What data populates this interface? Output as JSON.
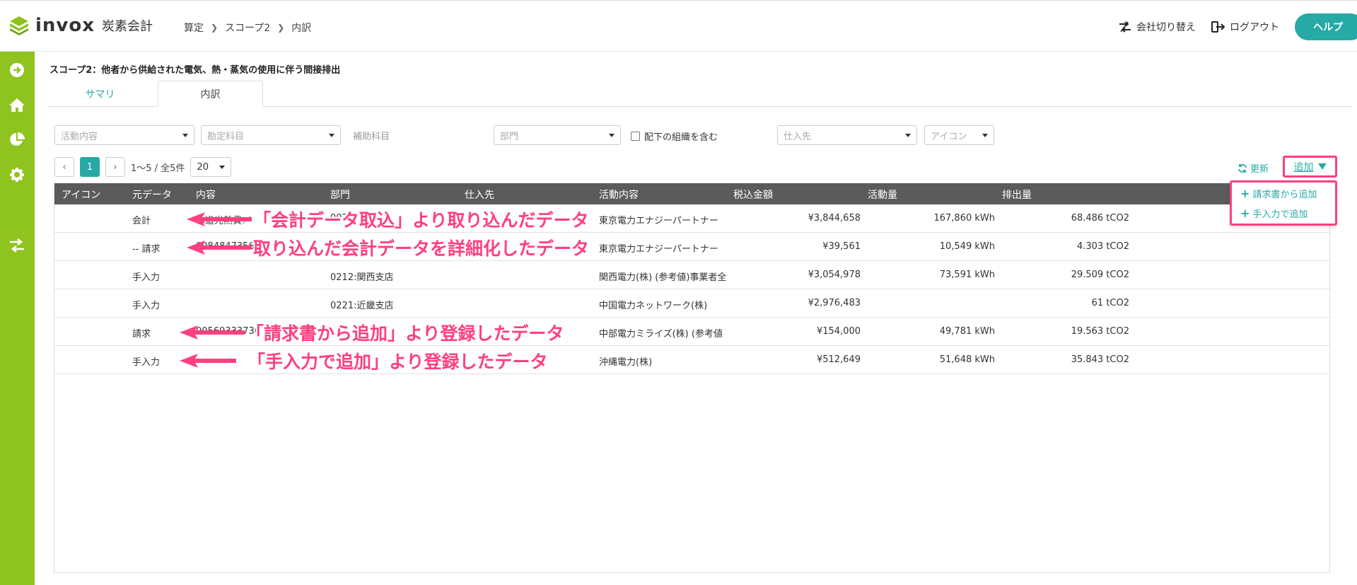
{
  "app": {
    "logo_text": "invox",
    "logo_sub": "炭素会計",
    "brand_color": "#8fc31f",
    "accent_color": "#27a9a6",
    "highlight_color": "#ff3f7f"
  },
  "breadcrumb": [
    "算定",
    "スコープ2",
    "内訳"
  ],
  "header": {
    "switch_company": "会社切り替え",
    "logout": "ログアウト",
    "help": "ヘルプ"
  },
  "sidebar": {
    "icons": [
      "arrow-right-circle-icon",
      "home-icon",
      "pie-chart-icon",
      "gear-icon",
      "swap-icon"
    ]
  },
  "page": {
    "title": "スコープ2：他者から供給された電気、熱・蒸気の使用に伴う間接排出"
  },
  "tabs": [
    {
      "label": "サマリ"
    },
    {
      "label": "内訳"
    }
  ],
  "filters": {
    "activity": "活動内容",
    "account": "勘定科目",
    "sub_account": "補助科目",
    "department": "部門",
    "include_sub_org": "配下の組織を含む",
    "supplier": "仕入先",
    "icon": "アイコン"
  },
  "pager": {
    "current": "1",
    "summary": "1〜5 / 全5件",
    "page_size": "20"
  },
  "toolbar": {
    "refresh": "更新",
    "add": "追加"
  },
  "add_menu": {
    "from_invoice": "請求書から追加",
    "manual": "手入力で追加"
  },
  "table": {
    "headers": [
      "アイコン",
      "元データ",
      "内容",
      "部門",
      "仕入先",
      "活動内容",
      "税込金額",
      "活動量",
      "排出量"
    ],
    "rows": [
      {
        "source": "会計",
        "content": "水道光熱費／",
        "dept": "002:",
        "activity": "東京電力エナジーパートナー",
        "amount": "¥3,844,658",
        "volume": "167,860 kWh",
        "emission": "68.486 tCO2"
      },
      {
        "source": "-- 請求",
        "content": "0084847356",
        "dept": "",
        "activity": "東京電力エナジーパートナー",
        "amount": "¥39,561",
        "volume": "10,549 kWh",
        "emission": "4.303 tCO2"
      },
      {
        "source": "手入力",
        "content": "",
        "dept": "0212:関西支店",
        "activity": "関西電力(株) (参考値)事業者全",
        "amount": "¥3,054,978",
        "volume": "73,591 kWh",
        "emission": "29.509 tCO2"
      },
      {
        "source": "手入力",
        "content": "",
        "dept": "0221:近畿支店",
        "activity": "中国電力ネットワーク(株)",
        "amount": "¥2,976,483",
        "volume": "",
        "emission": "61 tCO2"
      },
      {
        "source": "請求",
        "content": "00569333736",
        "dept": "",
        "activity": "中部電力ミライズ(株) (参考値",
        "amount": "¥154,000",
        "volume": "49,781 kWh",
        "emission": "19.563 tCO2"
      },
      {
        "source": "手入力",
        "content": "",
        "dept": "",
        "activity": "沖縄電力(株)",
        "amount": "¥512,649",
        "volume": "51,648 kWh",
        "emission": "35.843 tCO2"
      }
    ]
  },
  "annotations": [
    "「会計データ取込」より取り込んだデータ",
    "取り込んだ会計データを詳細化したデータ",
    "「請求書から追加」より登録したデータ",
    "「手入力で追加」より登録したデータ"
  ]
}
